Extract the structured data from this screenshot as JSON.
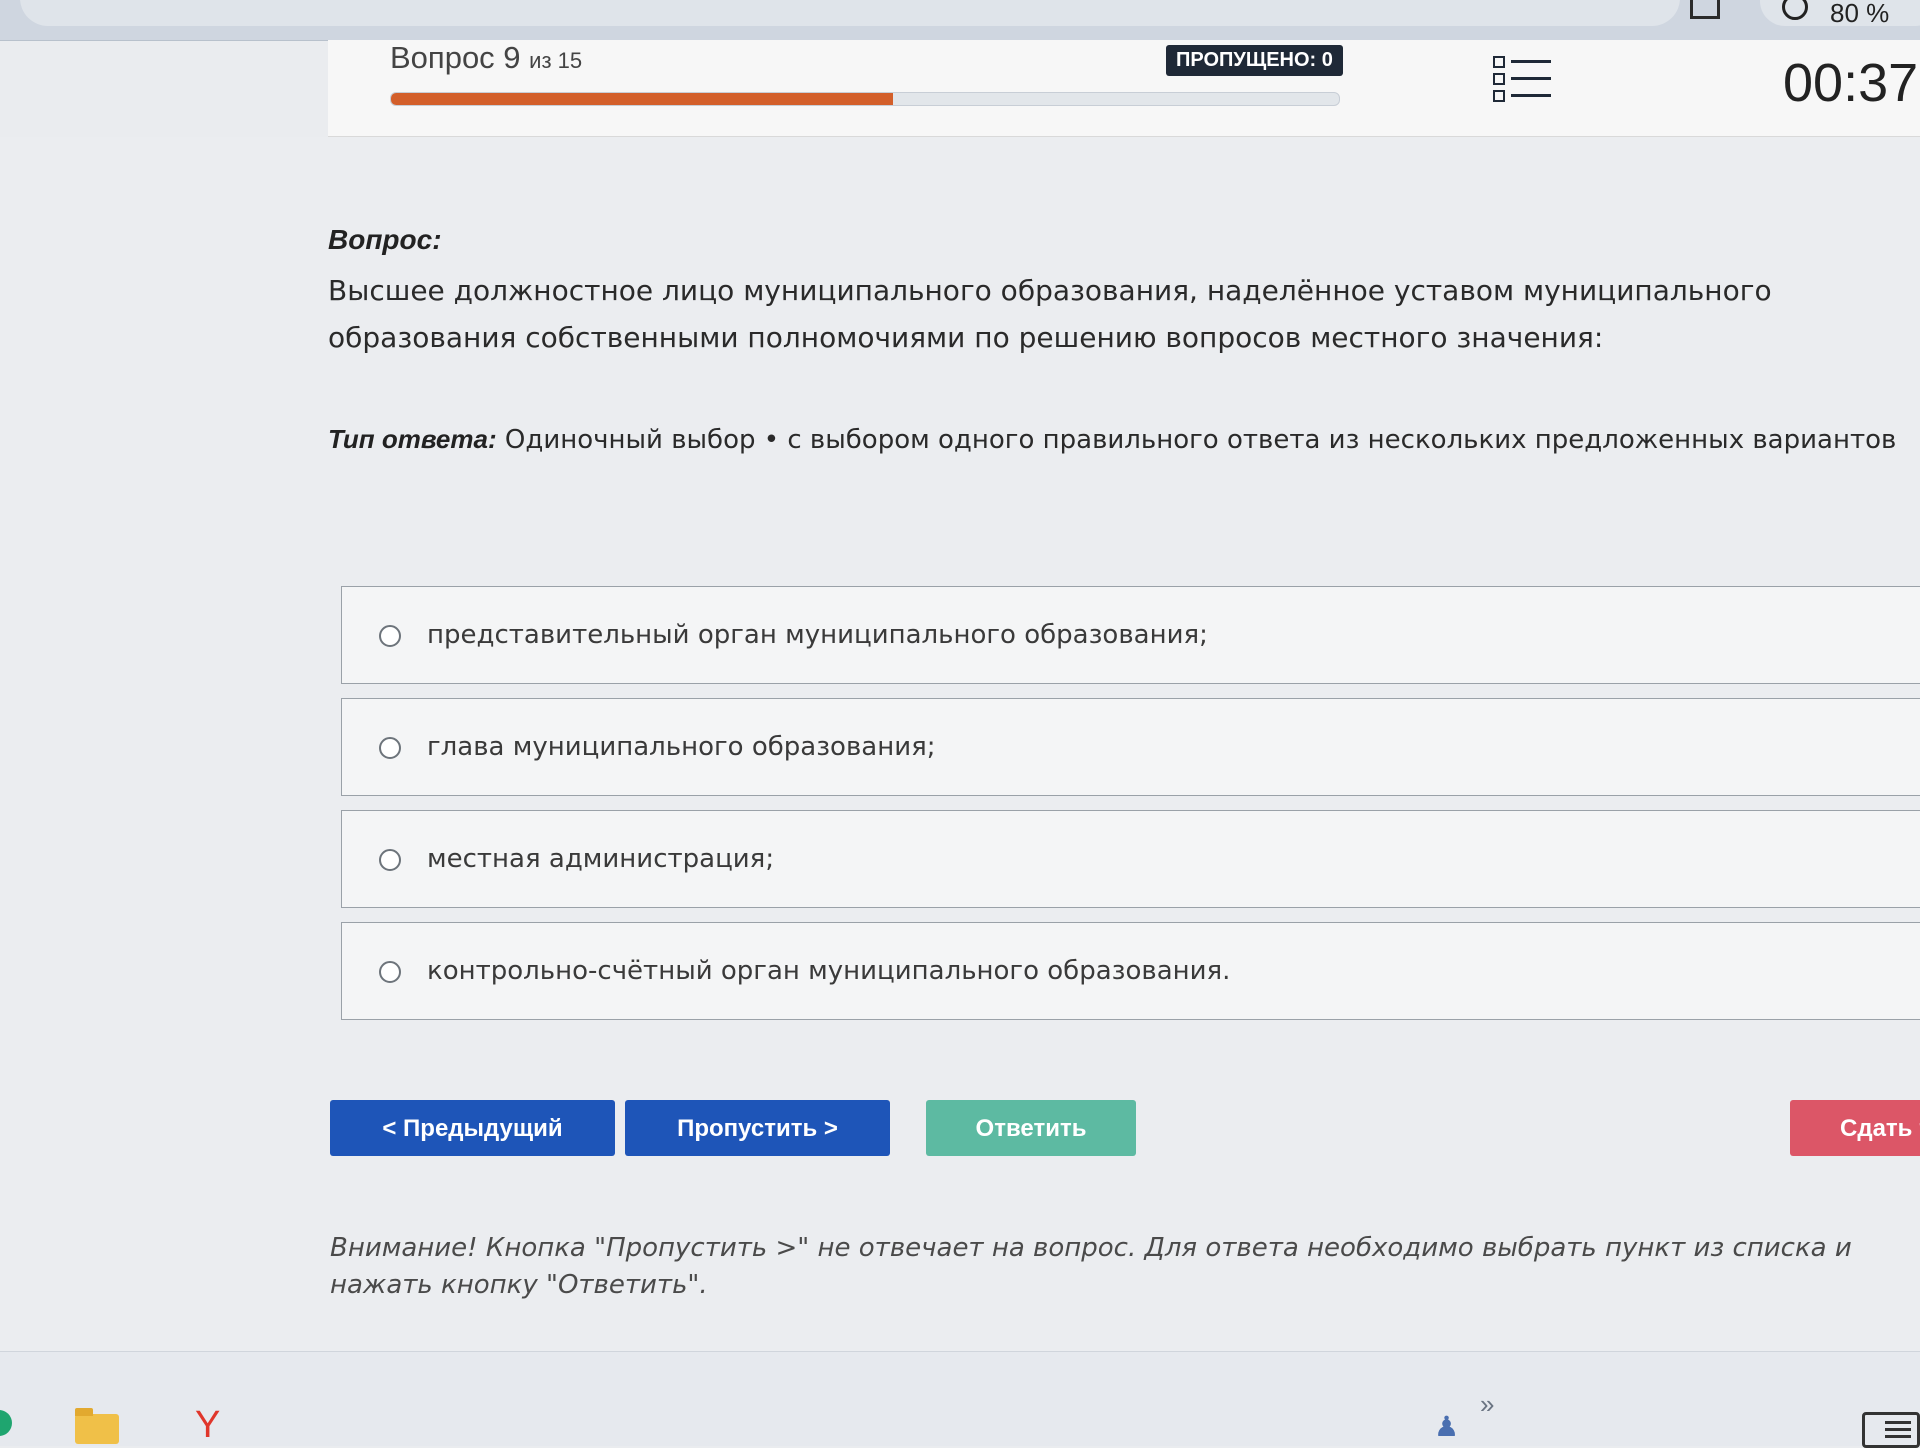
{
  "browser": {
    "zoom": "80 %"
  },
  "header": {
    "question_word": "Вопрос 9",
    "question_of": "из 15",
    "progress_percent": 53,
    "skipped_badge": "ПРОПУЩЕНО: 0",
    "timer": "00:37"
  },
  "question": {
    "label": "Вопрос:",
    "text": "Высшее должностное лицо муниципального образования, наделённое уставом муниципального образования собственными полномочиями по решению вопросов местного значения:",
    "answer_type_label": "Тип ответа:",
    "answer_type": "Одиночный выбор • с выбором одного правильного ответа из нескольких предложенных вариантов"
  },
  "options": [
    "представительный орган муниципального образования;",
    "глава муниципального образования;",
    "местная администрация;",
    "контрольно-счётный орган муниципального образования."
  ],
  "buttons": {
    "prev": "< Предыдущий",
    "skip": "Пропустить >",
    "answer": "Ответить",
    "submit": "Сдать т"
  },
  "notice": "Внимание! Кнопка \"Пропустить >\" не отвечает на вопрос. Для ответа необходимо выбрать пункт из списка и нажать кнопку \"Ответить\".",
  "taskbar": {
    "yandex_glyph": "Y",
    "chevron": "»"
  },
  "colors": {
    "progress": "#d35f2a",
    "primary_button": "#1e55b8",
    "answer_button": "#5dbaa2",
    "submit_button": "#dc5667",
    "badge": "#1f2937"
  }
}
